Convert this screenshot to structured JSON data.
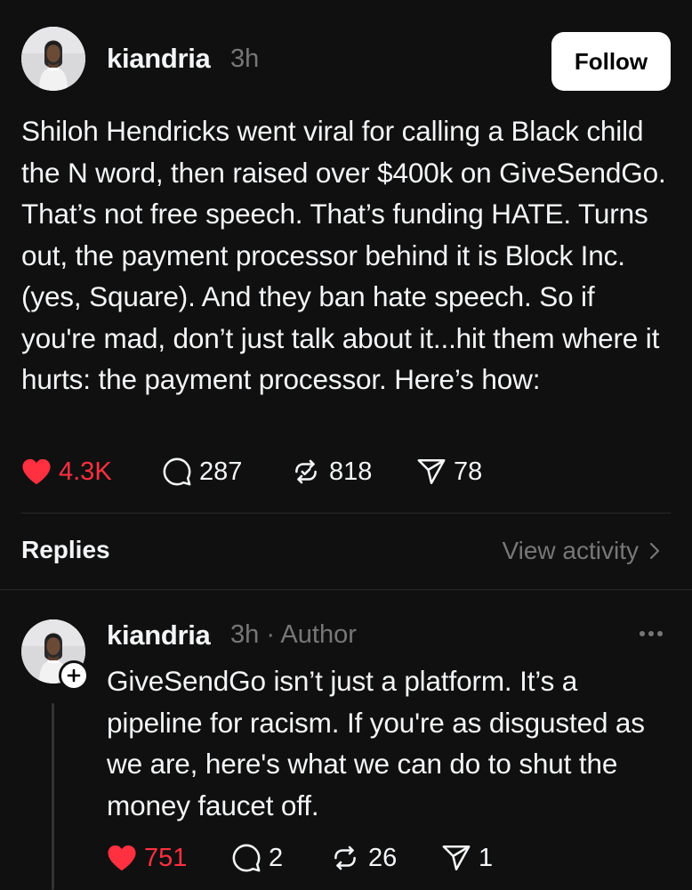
{
  "post": {
    "username": "kiandria",
    "time": "3h",
    "follow_label": "Follow",
    "text": "Shiloh Hendricks went viral for calling a Black child the N word, then raised over $400k on GiveSendGo. That’s not free speech. That’s funding HATE. Turns out, the payment processor behind it is Block Inc. (yes, Square). And they ban hate speech. So if you're mad, don’t just talk about it...hit them where it hurts: the payment processor. Here’s how:",
    "likes": "4.3K",
    "replies": "287",
    "reposts": "818",
    "shares": "78",
    "liked": true
  },
  "replies_section": {
    "label": "Replies",
    "view_activity": "View activity"
  },
  "reply": {
    "username": "kiandria",
    "meta": "3h · Author",
    "text": "GiveSendGo isn’t just a platform. It’s a pipeline for racism. If you're as disgusted as we are, here's what we can do to shut the money faucet off.",
    "likes": "751",
    "replies": "2",
    "reposts": "26",
    "shares": "1",
    "liked": true
  },
  "icons": {
    "like": "heart-icon",
    "reply": "comment-bubble-icon",
    "repost": "repost-icon",
    "share": "send-icon",
    "more": "more-horizontal-icon",
    "follow_plus": "plus-icon",
    "chevron": "chevron-right-icon"
  },
  "colors": {
    "background": "#101010",
    "text": "#f3f5f7",
    "secondary": "#777777",
    "like": "#ff3040",
    "button_bg": "#ffffff"
  }
}
